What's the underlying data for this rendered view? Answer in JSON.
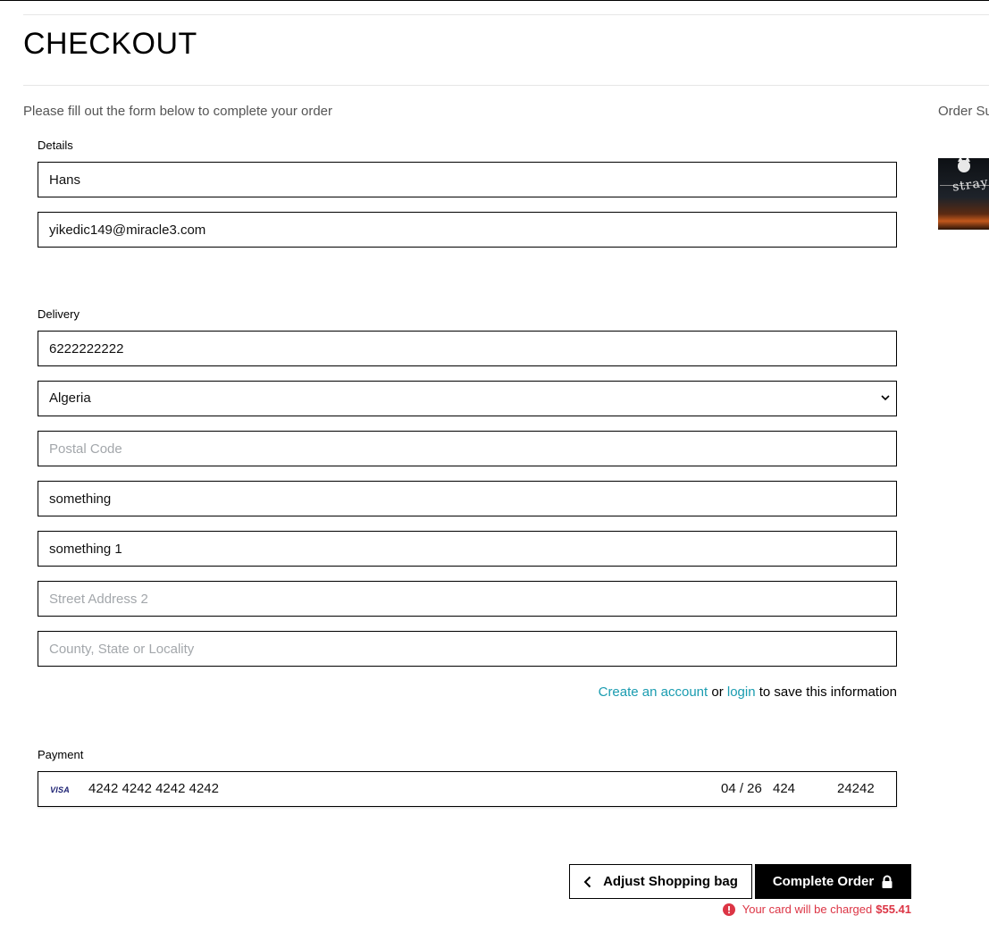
{
  "header": {
    "title": "CHECKOUT",
    "intro": "Please fill out the form below to complete your order"
  },
  "summary": {
    "title": "Order Su",
    "product_image": "stray-game-cover"
  },
  "details": {
    "label": "Details",
    "full_name": "Hans",
    "email": "yikedic149@miracle3.com"
  },
  "delivery": {
    "label": "Delivery",
    "phone": "6222222222",
    "country": "Algeria",
    "postal_code_placeholder": "Postal Code",
    "postal_code": "",
    "town_or_city": "something",
    "street_address_1": "something 1",
    "street_address_2_placeholder": "Street Address 2",
    "street_address_2": "",
    "county_placeholder": "County, State or Locality",
    "county": "",
    "account_prompt": {
      "create_link": "Create an account",
      "or_text": "or",
      "login_link": "login",
      "suffix": "to save this information"
    }
  },
  "payment": {
    "label": "Payment",
    "card_brand": "VISA",
    "card_number": "4242 4242 4242 4242",
    "expiry": "04 / 26",
    "cvc": "424",
    "zip": "24242"
  },
  "actions": {
    "adjust_label": "Adjust Shopping bag",
    "complete_label": "Complete Order",
    "charge_text": "Your card will be charged",
    "charge_amount": "$55.41"
  },
  "colors": {
    "link": "#1a9cb0",
    "error": "#dc3545",
    "primary_button": "#000000"
  }
}
